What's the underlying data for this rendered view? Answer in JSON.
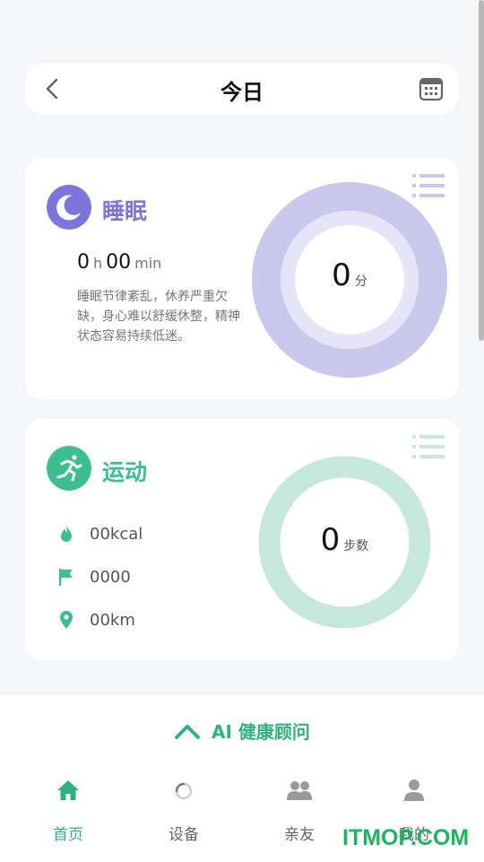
{
  "header": {
    "title": "今日"
  },
  "sleep": {
    "title": "睡眠",
    "hours": "0",
    "hours_unit": "h",
    "minutes": "00",
    "minutes_unit": "min",
    "description": "睡眠节律紊乱，休养严重欠缺，身心难以舒缓休整，精神状态容易持续低迷。",
    "score": "0",
    "score_unit": "分",
    "accent": "#7d74de"
  },
  "sport": {
    "title": "运动",
    "calories": "00kcal",
    "steps_goal": "0000",
    "distance": "00km",
    "steps": "0",
    "steps_unit": "步数",
    "accent": "#3cbf8e"
  },
  "ai": {
    "label": "AI 健康顾问"
  },
  "tabs": [
    {
      "label": "首页",
      "icon": "home-icon",
      "active": true
    },
    {
      "label": "设备",
      "icon": "device-loading-icon",
      "active": false
    },
    {
      "label": "亲友",
      "icon": "friends-icon",
      "active": false
    },
    {
      "label": "我的",
      "icon": "profile-icon",
      "active": false
    }
  ],
  "watermark": "ITMOP.COM"
}
